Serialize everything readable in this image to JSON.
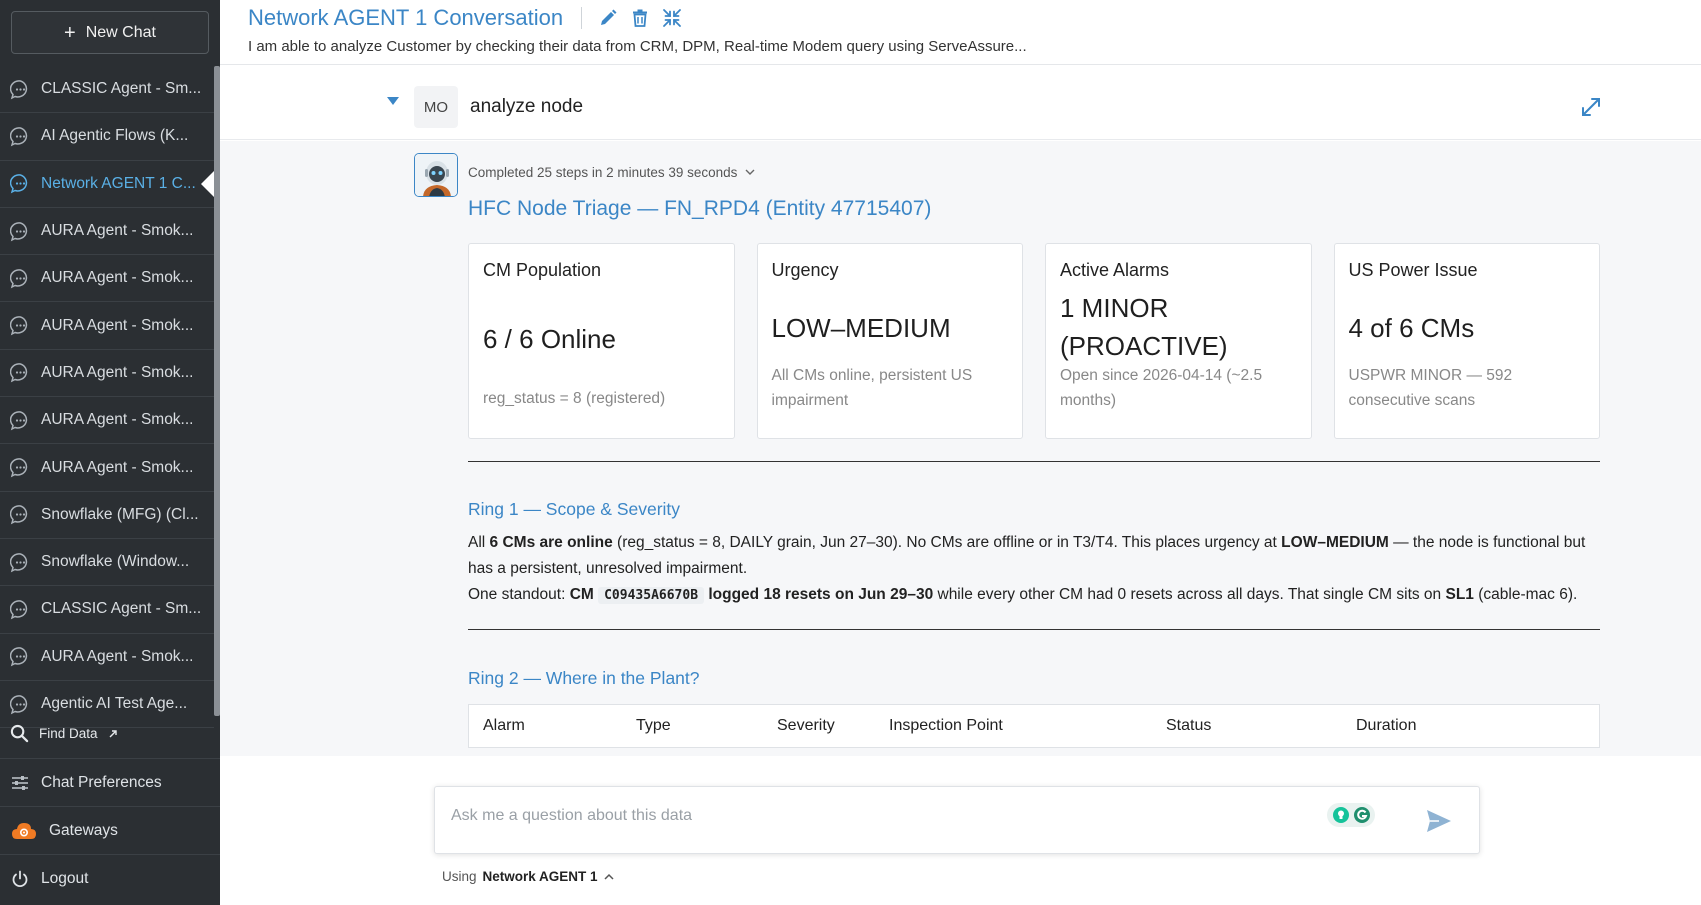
{
  "sidebar": {
    "new_chat_label": "New Chat",
    "items": [
      {
        "label": "CLASSIC Agent - Sm..."
      },
      {
        "label": "AI Agentic Flows (K..."
      },
      {
        "label": "Network AGENT 1 C..."
      },
      {
        "label": "AURA Agent - Smok..."
      },
      {
        "label": "AURA Agent - Smok..."
      },
      {
        "label": "AURA Agent - Smok..."
      },
      {
        "label": "AURA Agent - Smok..."
      },
      {
        "label": "AURA Agent - Smok..."
      },
      {
        "label": "AURA Agent - Smok..."
      },
      {
        "label": "Snowflake (MFG) (Cl..."
      },
      {
        "label": "Snowflake (Window..."
      },
      {
        "label": "CLASSIC Agent - Sm..."
      },
      {
        "label": "AURA Agent - Smok..."
      },
      {
        "label": "Agentic AI Test Age..."
      }
    ],
    "active_index": 2,
    "find_data_label": "Find Data",
    "chat_preferences_label": "Chat Preferences",
    "gateways_label": "Gateways",
    "logout_label": "Logout"
  },
  "header": {
    "title": "Network AGENT 1 Conversation",
    "subtitle": "I am able to analyze Customer by checking their data from CRM, DPM, Real-time Modem query using ServeAssure..."
  },
  "query": {
    "avatar_initials": "MO",
    "text": "analyze node"
  },
  "response": {
    "steps_text": "Completed 25 steps in 2 minutes 39 seconds",
    "title": "HFC Node Triage — FN_RPD4 (Entity 47715407)",
    "cards": [
      {
        "label": "CM Population",
        "value": "6 / 6 Online",
        "note": "reg_status = 8 (registered)"
      },
      {
        "label": "Urgency",
        "value": "LOW–MEDIUM",
        "note": "All CMs online, persistent US impairment"
      },
      {
        "label": "Active Alarms",
        "value": "1 MINOR (PROACTIVE)",
        "note": "Open since 2026-04-14 (~2.5 months)"
      },
      {
        "label": "US Power Issue",
        "value": "4 of 6 CMs",
        "note": "USPWR MINOR — 592 consecutive scans"
      }
    ],
    "ring1": {
      "title": "Ring 1 — Scope & Severity",
      "p1_a": "All ",
      "p1_b": "6 CMs are online",
      "p1_c": " (reg_status = 8, DAILY grain, Jun 27–30). No CMs are offline or in T3/T4. This places urgency at ",
      "p1_d": "LOW–MEDIUM",
      "p1_e": " — the node is functional but has a persistent, unresolved impairment.",
      "p2_a": "One standout: ",
      "p2_b": "CM",
      "p2_code": "C09435A6670B",
      "p2_c": "logged 18 resets on Jun 29–30",
      "p2_d": " while every other CM had 0 resets across all days. That single CM sits on ",
      "p2_e": "SL1",
      "p2_f": " (cable-mac 6)."
    },
    "ring2": {
      "title": "Ring 2 — Where in the Plant?",
      "columns": [
        "Alarm",
        "Type",
        "Severity",
        "Inspection Point",
        "Status",
        "Duration"
      ]
    }
  },
  "input": {
    "placeholder": "Ask me a question about this data",
    "using_label": "Using",
    "agent_name": "Network AGENT 1"
  },
  "colors": {
    "accent": "#3b86c6",
    "sidebar_bg": "#2b2f33",
    "gateway_orange": "#f07b24"
  }
}
